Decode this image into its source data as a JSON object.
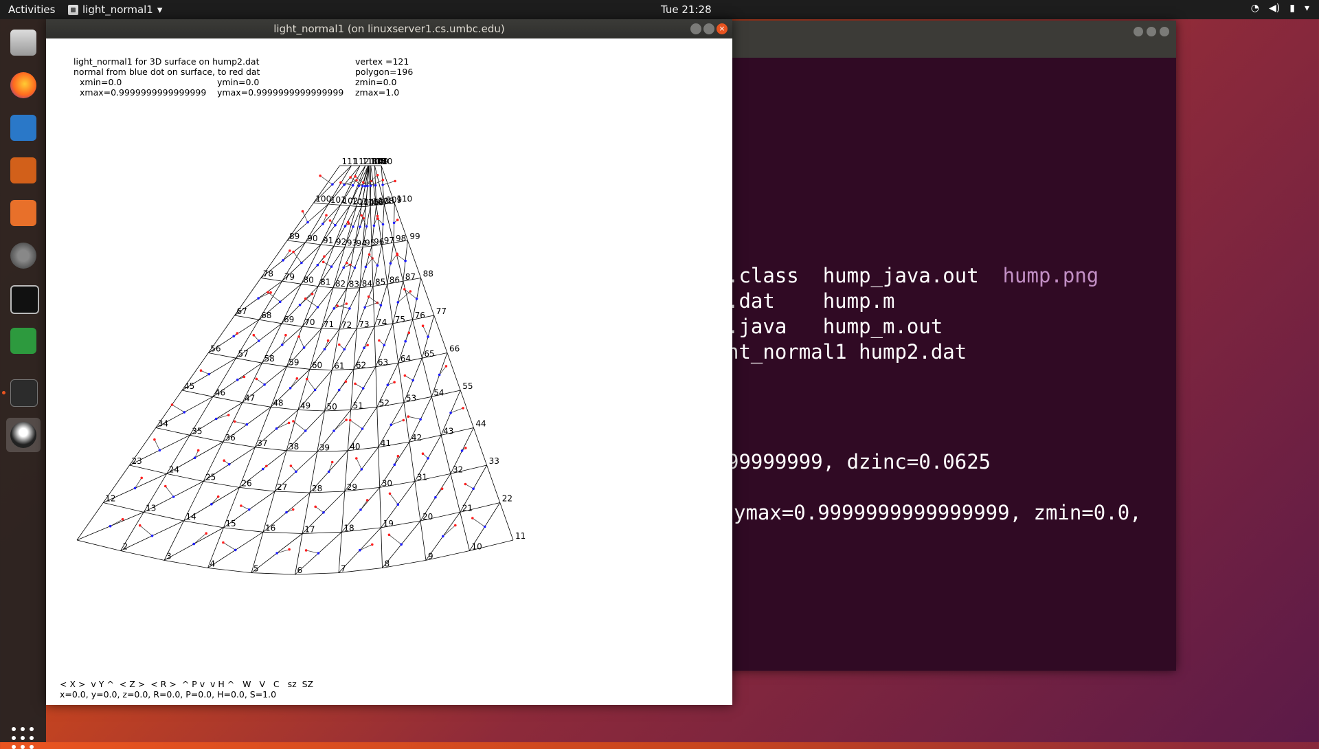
{
  "topbar": {
    "activities": "Activities",
    "app_name": "light_normal1",
    "app_menu_icon": "chevron-down-icon",
    "clock": "Tue 21:28",
    "status_icons": [
      "wifi-icon",
      "volume-icon",
      "battery-icon",
      "chevron-down-icon"
    ]
  },
  "dock": {
    "items": [
      "files-icon",
      "firefox-icon",
      "writer-icon",
      "impress-icon",
      "software-center-icon",
      "settings-icon",
      "xterm-icon",
      "calc-icon",
      "terminal-icon",
      "java-duke-icon"
    ],
    "show_apps_icon": "show-applications-icon"
  },
  "terminal": {
    "lines": [
      {
        "a": ".class",
        "b": "hump_java.out",
        "c": "hump.png"
      },
      {
        "a": ".dat",
        "b": "hump.m",
        "c": ""
      },
      {
        "a": ".java",
        "b": "hump_m.out",
        "c": ""
      },
      {
        "a": "ht_normal1",
        "b": "hump2.dat",
        "c": ""
      }
    ],
    "line5": "99999999, dzinc=0.0625",
    "line6": "ymax=0.9999999999999999, zmin=0.0,"
  },
  "window": {
    "title": "light_normal1 (on linuxserver1.cs.umbc.edu)",
    "info": {
      "line1": "light_normal1 for 3D surface on hump2.dat",
      "line2": "normal from blue dot on surface, to red dat",
      "xmin": "xmin=0.0",
      "xmax": "xmax=0.9999999999999999",
      "ymin": "ymin=0.0",
      "ymax": "ymax=0.9999999999999999",
      "vertex": "vertex =121",
      "polygon": "polygon=196",
      "zmin": "zmin=0.0",
      "zmax": "zmax=1.0"
    },
    "controls": "< X >  v Y ^  < Z >  < R >  ^ P v  v H ^   W   V   C   sz  SZ",
    "state": "x=0.0, y=0.0, z=0.0, R=0.0, P=0.0, H=0.0, S=1.0"
  },
  "plot": {
    "vertex_labels": [
      "2",
      "3",
      "4",
      "5",
      "6",
      "7",
      "8",
      "9",
      "10",
      "11",
      "12",
      "13",
      "14",
      "15",
      "16",
      "17",
      "18",
      "19",
      "20",
      "21",
      "22",
      "23",
      "24",
      "25",
      "26",
      "27",
      "28",
      "29",
      "30",
      "31",
      "32",
      "33",
      "34",
      "35",
      "36",
      "37",
      "38",
      "39",
      "40",
      "41",
      "42",
      "43",
      "44",
      "45",
      "46",
      "47",
      "48",
      "49",
      "50",
      "51",
      "52",
      "53",
      "54",
      "55",
      "56",
      "57",
      "58",
      "59",
      "60",
      "61",
      "62",
      "63",
      "64",
      "65",
      "66",
      "67",
      "68",
      "69",
      "70",
      "71",
      "72",
      "73",
      "74",
      "75",
      "76",
      "77",
      "78",
      "79",
      "80",
      "81",
      "82",
      "83",
      "84",
      "85",
      "86",
      "87",
      "88",
      "89",
      "90",
      "91",
      "92",
      "93",
      "94",
      "95",
      "96",
      "97",
      "98",
      "99",
      "100",
      "101",
      "102",
      "103",
      "104",
      "105",
      "106",
      "107",
      "108",
      "109",
      "110",
      "111",
      "112",
      "113",
      "114",
      "115",
      "116",
      "117",
      "118",
      "119",
      "120"
    ],
    "normal_color_start": "#1f1fff",
    "normal_color_end": "#ff2020",
    "mesh_color": "#000000"
  }
}
